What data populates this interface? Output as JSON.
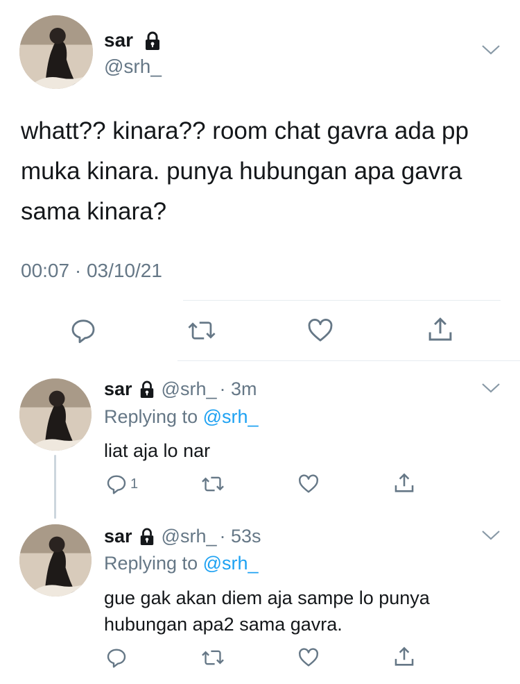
{
  "main_tweet": {
    "display_name": "sar",
    "handle": "@srh_",
    "text": "whatt?? kinara?? room chat gavra ada pp muka kinara. punya hubungan apa gavra sama kinara?",
    "timestamp": "00:07 · 03/10/21",
    "icons": [
      "reply-icon",
      "retweet-icon",
      "like-icon",
      "share-icon"
    ]
  },
  "replies": [
    {
      "display_name": "sar",
      "handle": "@srh_",
      "time": "· 3m",
      "replying_prefix": "Replying to",
      "replying_to": "@srh_",
      "text": "liat aja lo nar",
      "reply_count": "1"
    },
    {
      "display_name": "sar",
      "handle": "@srh_",
      "time": "· 53s",
      "replying_prefix": "Replying to",
      "replying_to": "@srh_",
      "text": "gue gak akan diem aja sampe lo punya hubungan apa2 sama gavra.",
      "reply_count": ""
    }
  ],
  "colors": {
    "text": "#14171a",
    "muted": "#657786",
    "link": "#1da1f2",
    "divider": "#e6ecf0"
  }
}
